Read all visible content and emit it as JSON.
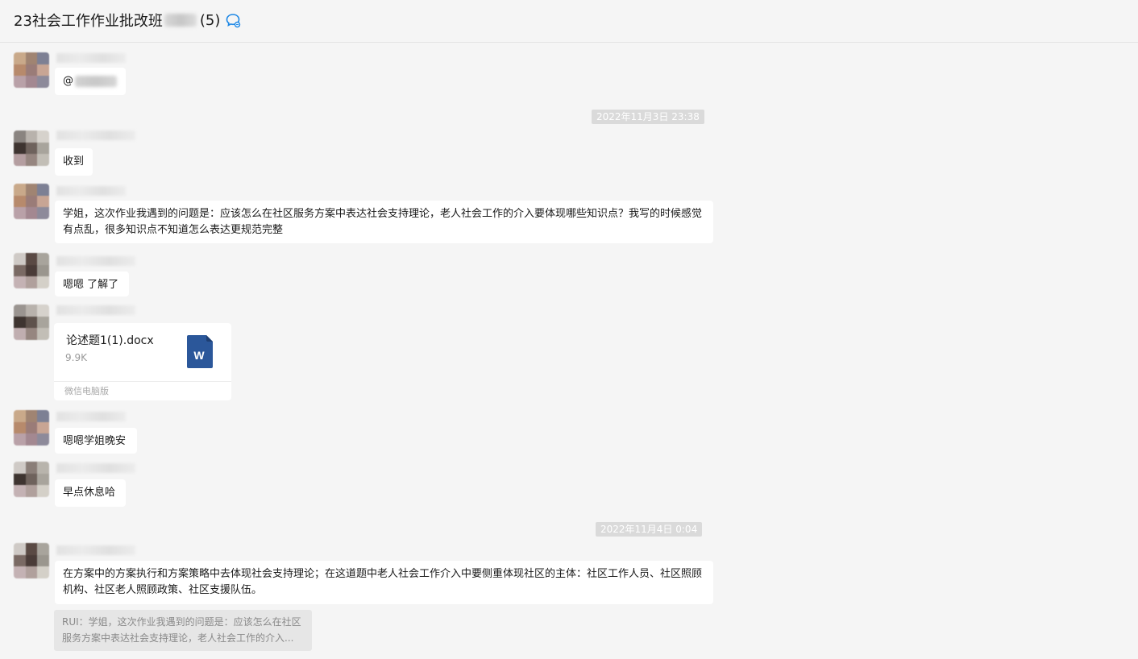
{
  "header": {
    "title": "23社会工作作业批改班",
    "count": "(5)",
    "icon": "chat-bubble-icon"
  },
  "colors": {
    "background": "#f5f5f5",
    "bubble": "#ffffff",
    "timestamp_bg": "#dadada",
    "word_blue": "#2b579a",
    "chat_icon_blue": "#1e88e5"
  },
  "messages": [
    {
      "text": "@"
    },
    {
      "text": "收到"
    },
    {
      "text": "学姐，这次作业我遇到的问题是：应该怎么在社区服务方案中表达社会支持理论，老人社会工作的介入要体现哪些知识点？我写的时候感觉有点乱，很多知识点不知道怎么表达更规范完整"
    },
    {
      "text": "嗯嗯 了解了"
    },
    {
      "text": "嗯嗯学姐晚安"
    },
    {
      "text": "早点休息哈"
    },
    {
      "text": "在方案中的方案执行和方案策略中去体现社会支持理论；在这道题中老人社会工作介入中要侧重体现社区的主体：社区工作人员、社区照顾机构、社区老人照顾政策、社区支援队伍。"
    }
  ],
  "timestamps": [
    "2022年11月3日 23:38",
    "2022年11月4日 0:04"
  ],
  "file": {
    "name": "论述题1(1).docx",
    "size": "9.9K",
    "source": "微信电脑版",
    "icon": "word-document-icon",
    "icon_letter": "W"
  },
  "quote": {
    "text": "RUI：学姐，这次作业我遇到的问题是：应该怎么在社区服务方案中表达社会支持理论，老人社会工作的介入..."
  }
}
